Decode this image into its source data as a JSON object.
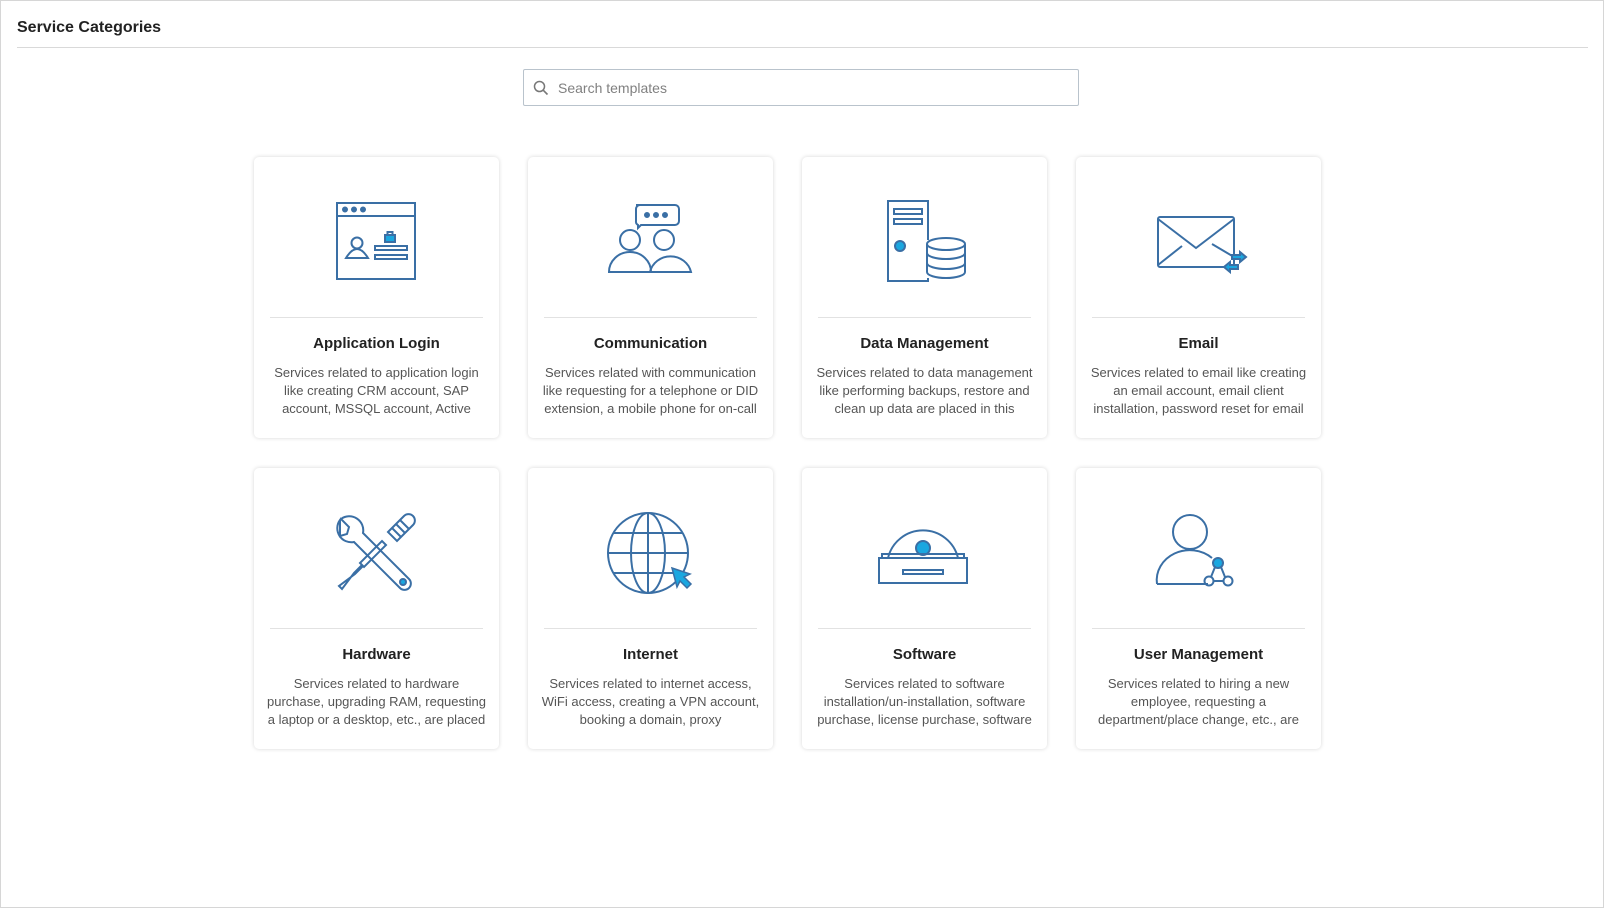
{
  "header": {
    "title": "Service Categories"
  },
  "search": {
    "placeholder": "Search templates",
    "value": ""
  },
  "colors": {
    "icon_stroke": "#3a6fa5",
    "icon_accent": "#1aa7e0"
  },
  "categories": [
    {
      "title": "Application Login",
      "icon": "browser-login-icon",
      "description": "Services related to application login like creating CRM account, SAP account, MSSQL account, Active"
    },
    {
      "title": "Communication",
      "icon": "people-chat-icon",
      "description": "Services related with communication like requesting for a telephone or DID extension, a mobile phone for on-call"
    },
    {
      "title": "Data Management",
      "icon": "server-database-icon",
      "description": "Services related to data management like performing backups, restore and clean up data are placed in this"
    },
    {
      "title": "Email",
      "icon": "envelope-transfer-icon",
      "description": "Services related to email like creating an email account, email client installation, password reset for email"
    },
    {
      "title": "Hardware",
      "icon": "wrench-screwdriver-icon",
      "description": "Services related to hardware purchase, upgrading RAM, requesting a laptop or a desktop, etc., are placed"
    },
    {
      "title": "Internet",
      "icon": "globe-cursor-icon",
      "description": "Services related to internet access, WiFi access, creating a VPN account, booking a domain, proxy"
    },
    {
      "title": "Software",
      "icon": "disc-drive-icon",
      "description": "Services related to software installation/un-installation, software purchase, license purchase, software"
    },
    {
      "title": "User Management",
      "icon": "user-network-icon",
      "description": "Services related to hiring a new employee, requesting a department/place change, etc., are"
    }
  ]
}
